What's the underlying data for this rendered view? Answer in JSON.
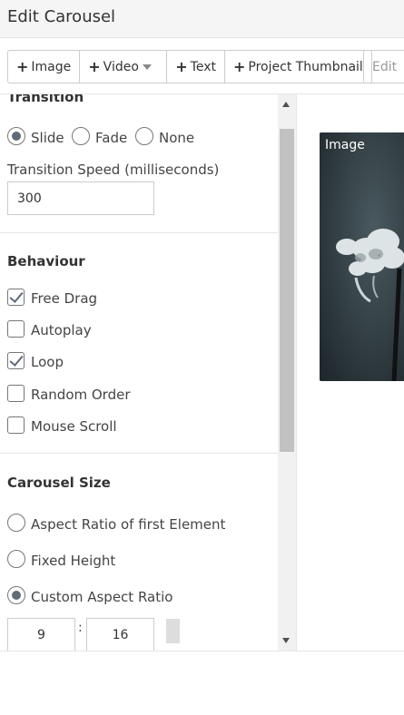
{
  "header": {
    "title": "Edit Carousel"
  },
  "toolbar": {
    "image": "Image",
    "video": "Video",
    "text": "Text",
    "project_thumbnail": "Project Thumbnail",
    "edit": "Edit"
  },
  "transition": {
    "title": "Transition",
    "options": [
      "Slide",
      "Fade",
      "None"
    ],
    "selected": "Slide",
    "speed_label": "Transition Speed (milliseconds)",
    "speed_value": "300"
  },
  "behaviour": {
    "title": "Behaviour",
    "items": [
      {
        "label": "Free Drag",
        "checked": true
      },
      {
        "label": "Autoplay",
        "checked": false
      },
      {
        "label": "Loop",
        "checked": true
      },
      {
        "label": "Random Order",
        "checked": false
      },
      {
        "label": "Mouse Scroll",
        "checked": false
      }
    ]
  },
  "carousel_size": {
    "title": "Carousel Size",
    "options": [
      "Aspect Ratio of first Element",
      "Fixed Height",
      "Custom Aspect Ratio"
    ],
    "selected": "Custom Aspect Ratio",
    "ratio_w": "9",
    "separator": ":",
    "ratio_h": "16"
  },
  "preview": {
    "label": "Image"
  },
  "colors": {
    "accent": "#5f6b78",
    "border": "#cccccc",
    "header_bg": "#f5f5f5"
  }
}
